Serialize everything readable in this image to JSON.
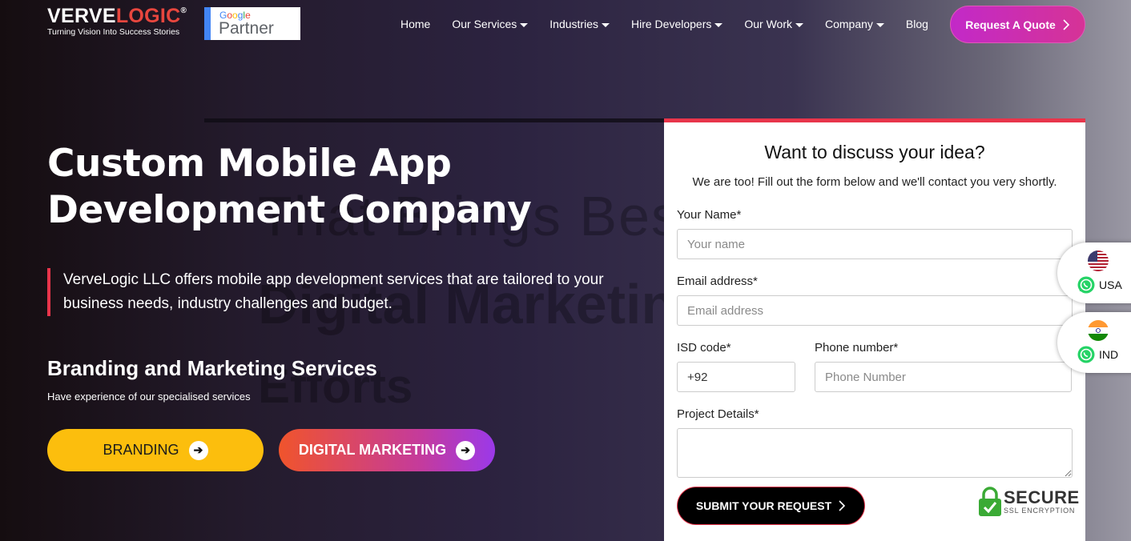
{
  "header": {
    "logo_part1": "VERVE",
    "logo_part2": "LOGIC",
    "logo_reg": "®",
    "tagline": "Turning Vision Into Success Stories",
    "partner_google": "Google",
    "partner_label": "Partner",
    "nav": [
      {
        "label": "Home",
        "dropdown": false
      },
      {
        "label": "Our Services",
        "dropdown": true
      },
      {
        "label": "Industries",
        "dropdown": true
      },
      {
        "label": "Hire Developers",
        "dropdown": true
      },
      {
        "label": "Our Work",
        "dropdown": true
      },
      {
        "label": "Company",
        "dropdown": true
      },
      {
        "label": "Blog",
        "dropdown": false
      }
    ],
    "quote_button": "Request A Quote"
  },
  "background_text": {
    "line1": "That Brings Best C",
    "line2": "Digital Marketin",
    "line3": "Efforts"
  },
  "hero": {
    "title_line1": "Custom Mobile App",
    "title_line2": "Development Company",
    "description": "VerveLogic LLC offers mobile app development services that are tailored to your business needs, industry challenges and budget.",
    "subheading": "Branding and Marketing Services",
    "subtext": "Have experience of our specialised services",
    "branding_button": "BRANDING",
    "digital_button": "DIGITAL MARKETING"
  },
  "form": {
    "title": "Want to discuss your idea?",
    "subtitle": "We are too! Fill out the form below and we'll contact you very shortly.",
    "name_label": "Your Name*",
    "name_placeholder": "Your name",
    "email_label": "Email address*",
    "email_placeholder": "Email address",
    "isd_label": "ISD code*",
    "isd_value": "+92",
    "phone_label": "Phone number*",
    "phone_placeholder": "Phone Number",
    "details_label": "Project Details*",
    "submit_button": "SUBMIT YOUR REQUEST",
    "secure_title": "SECURE",
    "secure_sub": "SSL ENCRYPTION"
  },
  "whatsapp": [
    {
      "label": "USA",
      "flag": "us-flag-icon"
    },
    {
      "label": "IND",
      "flag": "india-flag-icon"
    }
  ],
  "colors": {
    "accent_red": "#e8354b",
    "branding_yellow": "#fcbe0d",
    "quote_magenta": "#c229c8",
    "whatsapp_green": "#25d366"
  }
}
